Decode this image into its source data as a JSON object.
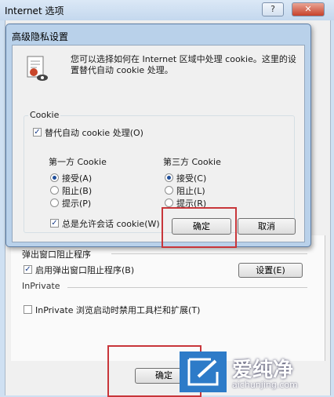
{
  "outer": {
    "title": "Internet 选项",
    "help_glyph": "?",
    "close_glyph": "✕",
    "popup_group_label": "弹出窗口阻止程序",
    "popup_checkbox_label": "启用弹出窗口阻止程序(B)",
    "popup_settings_button": "设置(E)",
    "inprivate_group_label": "InPrivate",
    "inprivate_checkbox_label": "InPrivate 浏览启动时禁用工具栏和扩展(T)",
    "ok_button": "确定"
  },
  "dialog": {
    "title": "高级隐私设置",
    "description": "您可以选择如何在 Internet 区域中处理 cookie。这里的设置替代自动 cookie 处理。",
    "cookie_group_label": "Cookie",
    "override_checkbox_label": "替代自动 cookie 处理(O)",
    "first_party": {
      "heading": "第一方 Cookie",
      "options": [
        "接受(A)",
        "阻止(B)",
        "提示(P)"
      ],
      "selected": "接受(A)"
    },
    "third_party": {
      "heading": "第三方 Cookie",
      "options": [
        "接受(C)",
        "阻止(L)",
        "提示(R)"
      ],
      "selected": "接受(C)"
    },
    "session_checkbox_label": "总是允许会话 cookie(W)",
    "ok_button": "确定",
    "cancel_button": "取消"
  },
  "watermark": {
    "text": "爱纯净",
    "url": "aichunjing.com"
  },
  "colors": {
    "highlight_red": "#c8363a",
    "watermark_blue": "#2d7bc8"
  }
}
